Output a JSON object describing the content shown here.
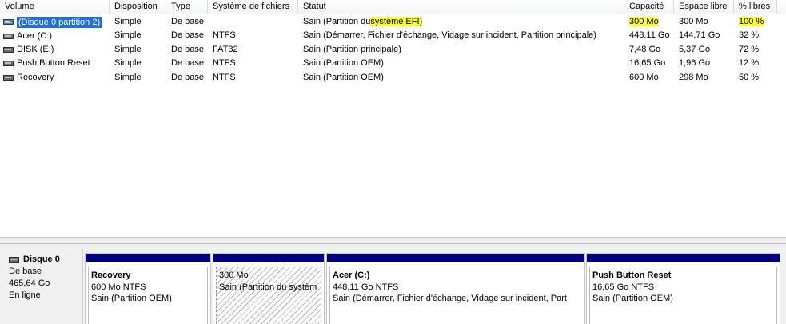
{
  "columns": {
    "volume": "Volume",
    "disposition": "Disposition",
    "type": "Type",
    "filesystem": "Système de fichiers",
    "status": "Statut",
    "capacity": "Capacité",
    "free_space": "Espace libre",
    "pct_free": "% libres"
  },
  "volumes": [
    {
      "name": "(Disque 0 partition 2)",
      "layout": "Simple",
      "type": "De base",
      "fs": "",
      "status_pre": "Sain (Partition du",
      "status_mark": "système EFI)",
      "capacity": "300 Mo",
      "free": "300 Mo",
      "pct": "100 %"
    },
    {
      "name": "Acer (C:)",
      "layout": "Simple",
      "type": "De base",
      "fs": "NTFS",
      "status": "Sain (Démarrer, Fichier d'échange, Vidage sur incident, Partition principale)",
      "capacity": "448,11 Go",
      "free": "144,71 Go",
      "pct": "32 %"
    },
    {
      "name": "DISK (E:)",
      "layout": "Simple",
      "type": "De base",
      "fs": "FAT32",
      "status": "Sain (Partition principale)",
      "capacity": "7,48 Go",
      "free": "5,37 Go",
      "pct": "72 %"
    },
    {
      "name": "Push Button Reset",
      "layout": "Simple",
      "type": "De base",
      "fs": "NTFS",
      "status": "Sain (Partition OEM)",
      "capacity": "16,65 Go",
      "free": "1,96 Go",
      "pct": "12 %"
    },
    {
      "name": "Recovery",
      "layout": "Simple",
      "type": "De base",
      "fs": "NTFS",
      "status": "Sain (Partition OEM)",
      "capacity": "600 Mo",
      "free": "298 Mo",
      "pct": "50 %"
    }
  ],
  "disk": {
    "title": "Disque 0",
    "type": "De base",
    "size": "465,64 Go",
    "state": "En ligne"
  },
  "partitions": [
    {
      "name": "Recovery",
      "size": "600 Mo NTFS",
      "status": "Sain (Partition OEM)"
    },
    {
      "name": "",
      "size": "300 Mo",
      "status": "Sain (Partition du systèm"
    },
    {
      "name": "Acer  (C:)",
      "size": "448,11 Go NTFS",
      "status": "Sain (Démarrer, Fichier d'échange, Vidage sur incident, Part"
    },
    {
      "name": "Push Button Reset",
      "size": "16,65 Go NTFS",
      "status": "Sain (Partition OEM)"
    }
  ],
  "colors": {
    "partition_bar": "#000080",
    "selection": "#1e6fd9",
    "highlight": "#fbff2e"
  },
  "icons": {
    "volume": "drive-icon",
    "disk": "disk-icon"
  }
}
